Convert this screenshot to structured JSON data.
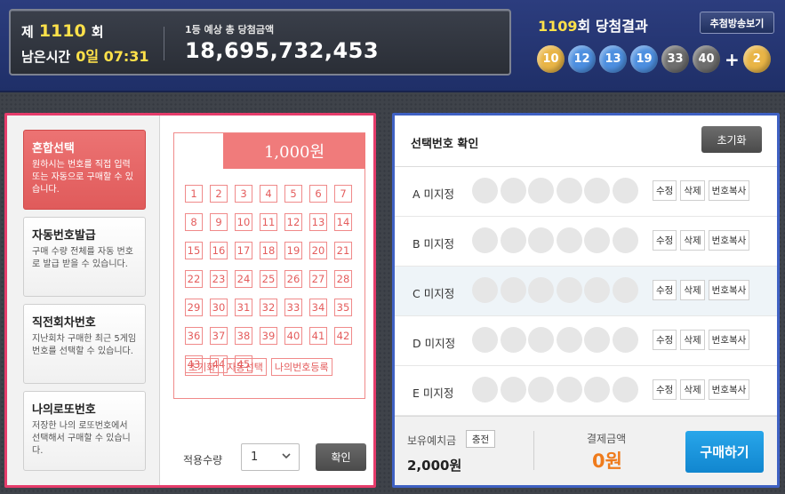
{
  "header": {
    "round_prefix": "제",
    "round_number": "1110",
    "round_suffix": "회",
    "remaining_label": "남은시간",
    "remaining_time": "0일 07:31",
    "prize_label": "1등 예상 총 당첨금액",
    "prize_amount": "18,695,732,453",
    "result_round": "1109",
    "result_suffix": "회 당첨결과",
    "broadcast_label": "추첨방송보기",
    "winning_numbers": [
      {
        "value": "10",
        "color": "#e9b546"
      },
      {
        "value": "12",
        "color": "#4d8fe0"
      },
      {
        "value": "13",
        "color": "#4d8fe0"
      },
      {
        "value": "19",
        "color": "#4d8fe0"
      },
      {
        "value": "33",
        "color": "#6e6e6e"
      },
      {
        "value": "40",
        "color": "#6e6e6e"
      }
    ],
    "plus": "+",
    "bonus_number": {
      "value": "2",
      "color": "#e9b546"
    }
  },
  "modes": [
    {
      "title": "혼합선택",
      "desc": "원하시는 번호를 직접 입력 또는 자동으로 구매할 수 있습니다."
    },
    {
      "title": "자동번호발급",
      "desc": "구매 수량 전체를 자동 번호로 발급 받을 수 있습니다."
    },
    {
      "title": "직전회차번호",
      "desc": "지난회차 구매한 최근 5게임 번호를 선택할 수 있습니다."
    },
    {
      "title": "나의로또번호",
      "desc": "저장한 나의 로또번호에서 선택해서 구매할 수 있습니다."
    }
  ],
  "slip": {
    "price": "1,000원",
    "reset_label": "초기화",
    "auto_label": "자동선택",
    "my_numbers_label": "나의번호등록"
  },
  "quantity": {
    "label": "적용수량",
    "value": "1",
    "confirm_label": "확인"
  },
  "selection": {
    "title": "선택번호 확인",
    "reset_label": "초기화",
    "rows": [
      {
        "label": "A 미지정"
      },
      {
        "label": "B 미지정"
      },
      {
        "label": "C 미지정"
      },
      {
        "label": "D 미지정"
      },
      {
        "label": "E 미지정"
      }
    ],
    "edit_label": "수정",
    "delete_label": "삭제",
    "copy_label": "번호복사"
  },
  "footer": {
    "balance_label": "보유예치금",
    "charge_label": "충전",
    "balance_value": "2,000원",
    "payment_label": "결제금액",
    "payment_value": "0원",
    "buy_label": "구매하기"
  },
  "colors": {
    "left_border": "#e63c6b",
    "right_border": "#3f61c3",
    "accent_red": "#f07b7b",
    "buy_blue": "#1a96de",
    "pay_orange": "#ef7b1c"
  }
}
